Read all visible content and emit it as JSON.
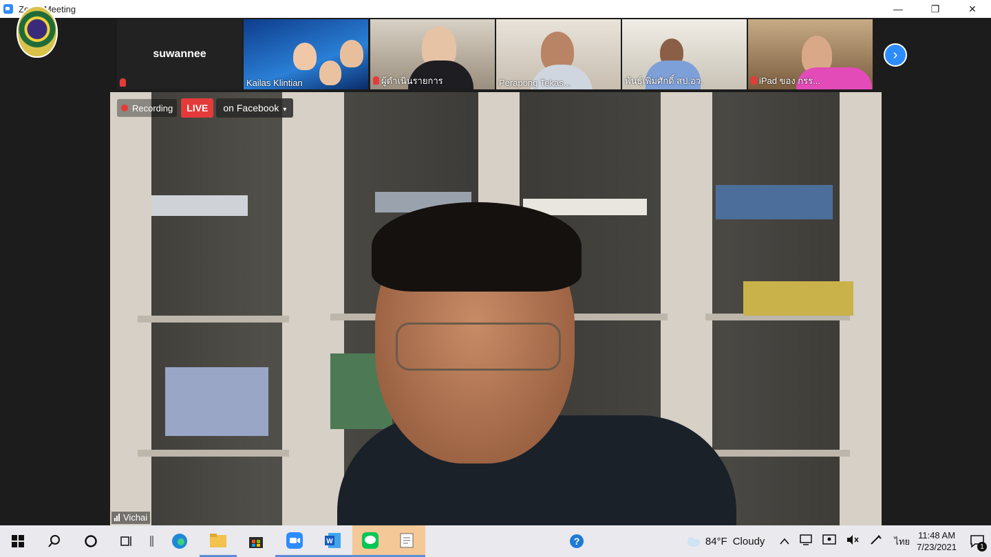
{
  "window": {
    "title": "Zoom Meeting",
    "minimize": "—",
    "restore": "❐",
    "close": "✕"
  },
  "strip": {
    "tiles": [
      {
        "name": "suwannee",
        "muted": true
      },
      {
        "name": "Kailas Klintian",
        "muted": false
      },
      {
        "name": "ผู้ดำเนินรายการ",
        "muted": true
      },
      {
        "name": "Perapong Tekas...",
        "muted": false
      },
      {
        "name": "พันธุ์เพิ่มศักดิ์ สป.อว.",
        "muted": false
      },
      {
        "name": "iPad ของ กรร...",
        "muted": true
      }
    ],
    "next_icon": "›"
  },
  "main": {
    "recording_label": "Recording",
    "live_label": "LIVE",
    "live_target": "on Facebook",
    "caret": "▾",
    "speaker_name": "Vichai"
  },
  "taskbar": {
    "weather_temp": "84°F",
    "weather_desc": "Cloudy",
    "language": "ไทย",
    "time": "11:48 AM",
    "date": "7/23/2021",
    "notification_count": "1"
  },
  "colors": {
    "zoom_blue": "#2d8cff",
    "live_red": "#e53a3a",
    "taskbar_bg": "#e9e9ee"
  }
}
